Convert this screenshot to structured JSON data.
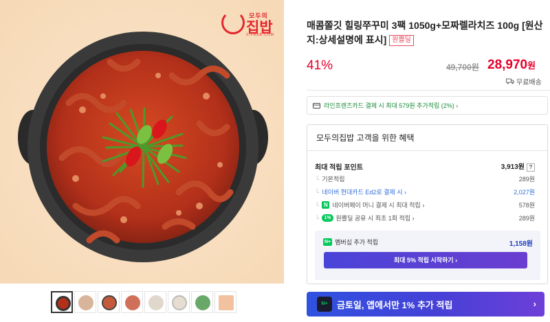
{
  "brand": {
    "small": "모두의",
    "big": "집밥",
    "url": "ZIPBAB.COM"
  },
  "thumbnail_count": 8,
  "product": {
    "title": "매콤쫄깃 힐링쭈꾸미 3팩 1050g+모짜렐라치즈 100g [원산지:상세설명에 표시]",
    "badge": "원쁠딜",
    "discount": "41%",
    "original_price": "49,700원",
    "price_number": "28,970",
    "price_unit": "원",
    "shipping": "무료배송"
  },
  "card_promo": "라인프렌즈카드 결제 시 최대 579원 추가적립 (2%) ›",
  "benefits": {
    "heading": "모두의집밥 고객을 위한 혜택",
    "max_points_label": "최대 적립 포인트",
    "max_points_value": "3,913원",
    "help_icon": "?",
    "rows": [
      {
        "label": "기본적립",
        "value": "289원"
      },
      {
        "label": "네이버 현대카드 Ed2로 결제 시 ›",
        "value": "2,027원"
      },
      {
        "label": "네이버페이 머니 결제 시 최대 적립 ›",
        "value": "578원"
      },
      {
        "label": "원쁠딜 공유 시 최초 1회 적립 ›",
        "value": "289원",
        "pill": "1%"
      }
    ],
    "membership_label": "멤버십 추가 적립",
    "membership_value": "1,158원",
    "membership_button": "최대 5% 적립 시작하기 ›"
  },
  "banner": {
    "text": "금토일, 앱에서만 1% 추가 적립",
    "arrow": "›",
    "icon_text": "N+"
  },
  "colors": {
    "accent_red": "#e4002b",
    "naver_green": "#03c75a",
    "membership_purple": "#5a40d6"
  }
}
